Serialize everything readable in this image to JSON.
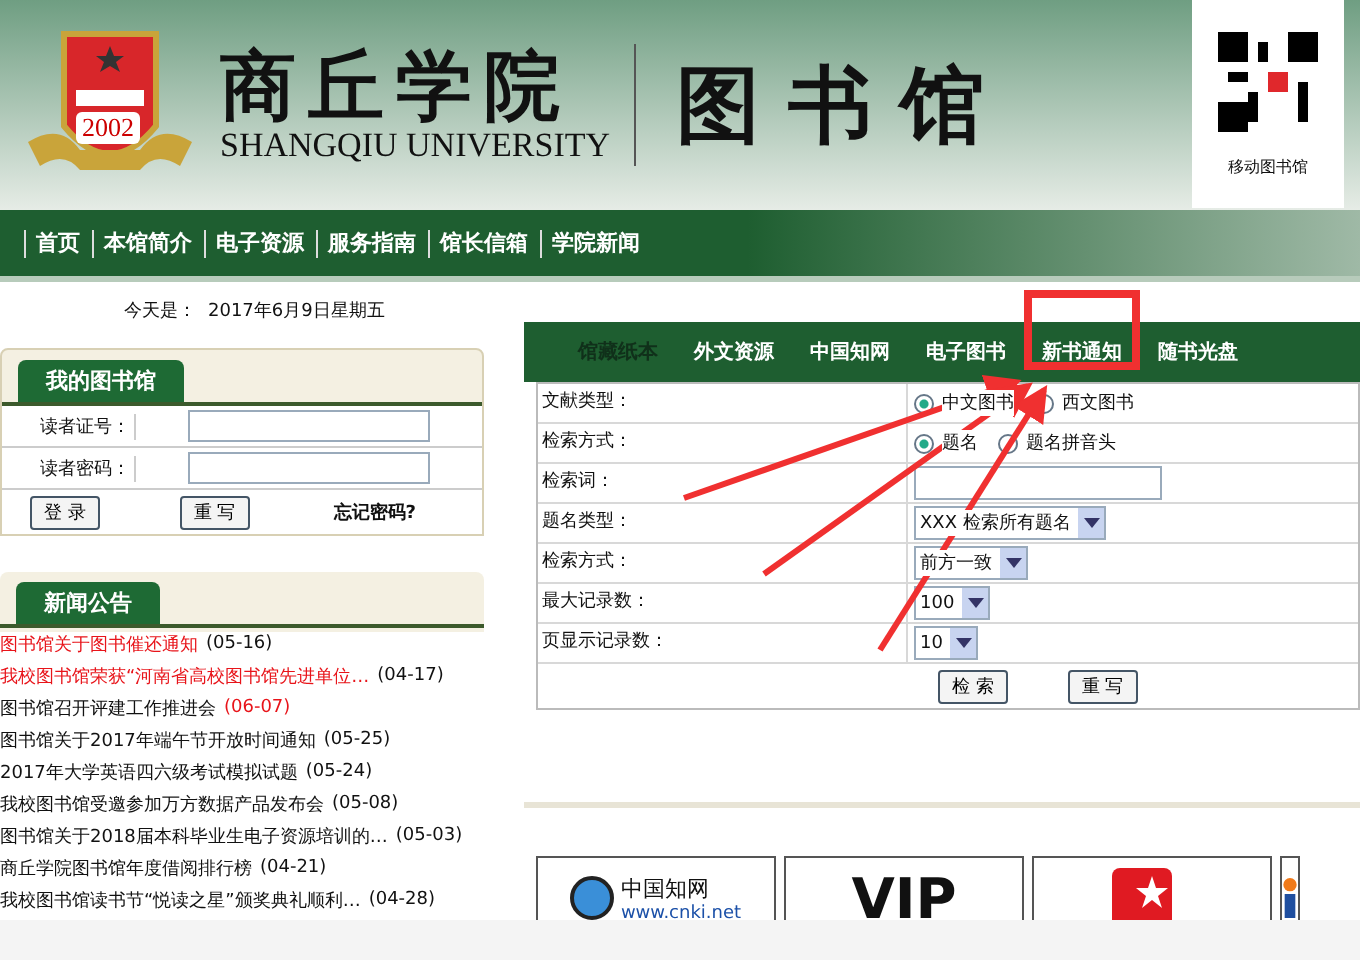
{
  "header": {
    "emblem_year": "2002",
    "school_name": "商丘学院",
    "school_name_en": "SHANGQIU UNIVERSITY",
    "library_name": "图书馆",
    "qr_caption": "移动图书馆"
  },
  "nav": [
    {
      "label": "首页"
    },
    {
      "label": "本馆简介"
    },
    {
      "label": "电子资源"
    },
    {
      "label": "服务指南"
    },
    {
      "label": "馆长信箱"
    },
    {
      "label": "学院新闻"
    }
  ],
  "date_line": {
    "label": "今天是：",
    "value": "2017年6月9日星期五"
  },
  "login": {
    "title": "我的图书馆",
    "fields": [
      {
        "label": "读者证号："
      },
      {
        "label": "读者密码："
      }
    ],
    "buttons": [
      "登 录",
      "重 写"
    ],
    "forgot_link": "忘记密码?"
  },
  "news": {
    "title": "新闻公告",
    "items": [
      {
        "title": "图书馆关于图书催还通知",
        "date": "(05-16)",
        "title_emphasis": true,
        "date_emphasis": false
      },
      {
        "title": "我校图书馆荣获“河南省高校图书馆先进单位…",
        "date": "(04-17)",
        "title_emphasis": true,
        "date_emphasis": false
      },
      {
        "title": "图书馆召开评建工作推进会",
        "date": "(06-07)",
        "title_emphasis": false,
        "date_emphasis": true
      },
      {
        "title": "图书馆关于2017年端午节开放时间通知",
        "date": "(05-25)",
        "title_emphasis": false,
        "date_emphasis": false
      },
      {
        "title": "2017年大学英语四六级考试模拟试题",
        "date": "(05-24)",
        "title_emphasis": false,
        "date_emphasis": false
      },
      {
        "title": "我校图书馆受邀参加万方数据产品发布会",
        "date": "(05-08)",
        "title_emphasis": false,
        "date_emphasis": false
      },
      {
        "title": "图书馆关于2018届本科毕业生电子资源培训的…",
        "date": "(05-03)",
        "title_emphasis": false,
        "date_emphasis": false
      },
      {
        "title": "商丘学院图书馆年度借阅排行榜",
        "date": "(04-21)",
        "title_emphasis": false,
        "date_emphasis": false
      },
      {
        "title": "我校图书馆读书节“悦读之星”颁奖典礼顺利…",
        "date": "(04-28)",
        "title_emphasis": false,
        "date_emphasis": false
      }
    ]
  },
  "search_tabs": [
    {
      "label": "馆藏纸本",
      "selected": true
    },
    {
      "label": "外文资源",
      "selected": false
    },
    {
      "label": "中国知网",
      "selected": false
    },
    {
      "label": "电子图书",
      "selected": false
    },
    {
      "label": "新书通知",
      "selected": false,
      "annotated": true
    },
    {
      "label": "随书光盘",
      "selected": false
    }
  ],
  "search_form": {
    "rows": [
      {
        "label": "文献类型：",
        "kind": "radio",
        "options": [
          {
            "label": "中文图书",
            "selected": true
          },
          {
            "label": "西文图书",
            "selected": false
          }
        ]
      },
      {
        "label": "检索方式：",
        "kind": "radio",
        "options": [
          {
            "label": "题名",
            "selected": true
          },
          {
            "label": "题名拼音头",
            "selected": false
          }
        ]
      },
      {
        "label": "检索词：",
        "kind": "text"
      },
      {
        "label": "题名类型：",
        "kind": "select",
        "value": "XXX 检索所有题名"
      },
      {
        "label": "检索方式：",
        "kind": "select",
        "value": "前方一致"
      },
      {
        "label": "最大记录数：",
        "kind": "select",
        "value": "100"
      },
      {
        "label": "页显示记录数：",
        "kind": "select",
        "value": "10"
      }
    ],
    "buttons": [
      "检 索",
      "重 写"
    ]
  },
  "resources": [
    {
      "kind": "cnki",
      "name": "中国知网",
      "url": "www.cnki.net"
    },
    {
      "kind": "vip",
      "name": "VIP"
    },
    {
      "kind": "star"
    },
    {
      "kind": "person"
    }
  ]
}
